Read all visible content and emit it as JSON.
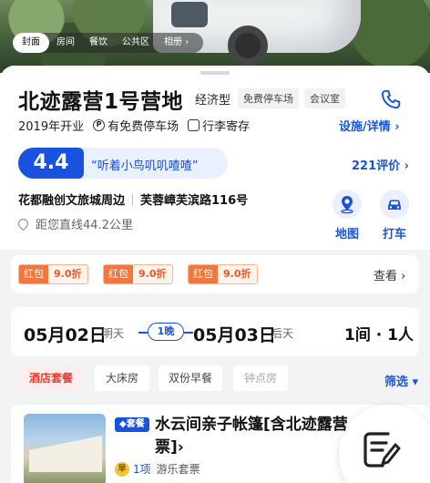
{
  "hero": {
    "tabs": [
      "封面",
      "房间",
      "餐饮",
      "公共区",
      "相册"
    ],
    "more_glyph": "›"
  },
  "hotel": {
    "name": "北迹露营1号营地",
    "grade": "经济型",
    "tags": [
      "免费停车场",
      "会议室"
    ],
    "opened": "2019年开业",
    "features": [
      "有免费停车场",
      "行李寄存"
    ],
    "facilities_link": "设施/详情 ›",
    "score": "4.4",
    "review_quote": "“听着小鸟叽叽喳喳”",
    "reviews_link": "221评价 ›",
    "area": "花都融创文旅城周边",
    "street": "芙蓉嶂芙滨路116号",
    "distance": "距您直线44.2公里",
    "actions": {
      "map": "地图",
      "taxi": "打车"
    },
    "icons": [
      "phone-icon",
      "parking-icon",
      "luggage-icon",
      "location-pin-icon",
      "map-icon",
      "car-icon"
    ]
  },
  "promo": {
    "coupons": [
      {
        "label": "红包",
        "value": "9.0折"
      },
      {
        "label": "红包",
        "value": "9.0折"
      },
      {
        "label": "红包",
        "value": "9.0折"
      }
    ],
    "see_more": "查看 ›"
  },
  "booking": {
    "checkin_date": "05月02日",
    "checkin_day": "明天",
    "nights": "1晚",
    "checkout_date": "05月03日",
    "checkout_day": "后天",
    "guests": "1间 · 1人"
  },
  "filters": {
    "items": [
      "酒店套餐",
      "大床房",
      "双份早餐",
      "钟点房"
    ],
    "screen": "筛选 ▾"
  },
  "room": {
    "badge": "◆套餐",
    "name": "水云间亲子帐篷[含北迹露营票]",
    "name_arrow": "›",
    "bf_icon": "早",
    "bf_count": "1项",
    "bf_text": "游乐套票"
  },
  "colors": {
    "accent": "#1a52e0",
    "coupon": "#f5753b",
    "active_filter": "#e23c2f"
  }
}
